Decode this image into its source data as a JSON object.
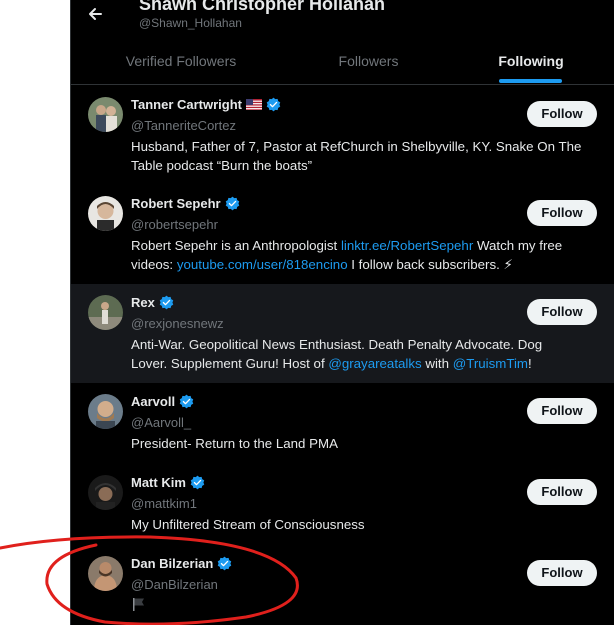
{
  "header": {
    "profile_name": "Shawn Christopher Hollahan",
    "profile_handle": "@Shawn_Hollahan"
  },
  "tabs": [
    {
      "label": "Verified Followers"
    },
    {
      "label": "Followers"
    },
    {
      "label": "Following",
      "active": true
    }
  ],
  "users": [
    {
      "name": "Tanner Cartwright",
      "flag": "us-flag-icon",
      "verified": true,
      "handle": "@TanneriteCortez",
      "bio_line1": "Husband, Father of 7, Pastor at RefChurch in Shelbyville, KY. Snake On The",
      "bio_line2": "Table podcast “Burn the boats”",
      "button": "Follow"
    },
    {
      "name": "Robert Sepehr",
      "verified": true,
      "handle": "@robertsepehr",
      "bio_l1_a": "Robert Sepehr is an Anthropologist ",
      "bio_l1_link": "linktr.ee/RobertSepehr",
      "bio_l1_b": " Watch my free",
      "bio_l2_a": "videos: ",
      "bio_l2_link": "youtube.com/user/818encino",
      "bio_l2_b": " I follow back subscribers. ⚡",
      "button": "Follow"
    },
    {
      "name": "Rex",
      "verified": true,
      "handle": "@rexjonesnewz",
      "bio_line1": "Anti-War. Geopolitical News Enthusiast. Death Penalty Advocate. Dog",
      "bio_l2_a": "Lover. Supplement Guru! Host of ",
      "bio_l2_link1": "@grayareatalks",
      "bio_l2_mid": " with ",
      "bio_l2_link2": "@TruismTim",
      "bio_l2_end": "!",
      "button": "Follow"
    },
    {
      "name": "Aarvoll",
      "verified": true,
      "handle": "@Aarvoll_",
      "bio_line1": "President- Return to the Land PMA",
      "button": "Follow"
    },
    {
      "name": "Matt Kim",
      "verified": true,
      "handle": "@mattkim1",
      "bio_line1": "My Unfiltered Stream of Consciousness",
      "button": "Follow"
    },
    {
      "name": "Dan Bilzerian",
      "verified": true,
      "handle": "@DanBilzerian",
      "bio_icon": "black-flag-icon",
      "button": "Follow"
    }
  ],
  "colors": {
    "background": "#000000",
    "text": "#e7e9ea",
    "secondary_text": "#71767b",
    "accent": "#1d9bf0",
    "follow_button": "#eff3f4",
    "annotation": "#e0201c"
  }
}
